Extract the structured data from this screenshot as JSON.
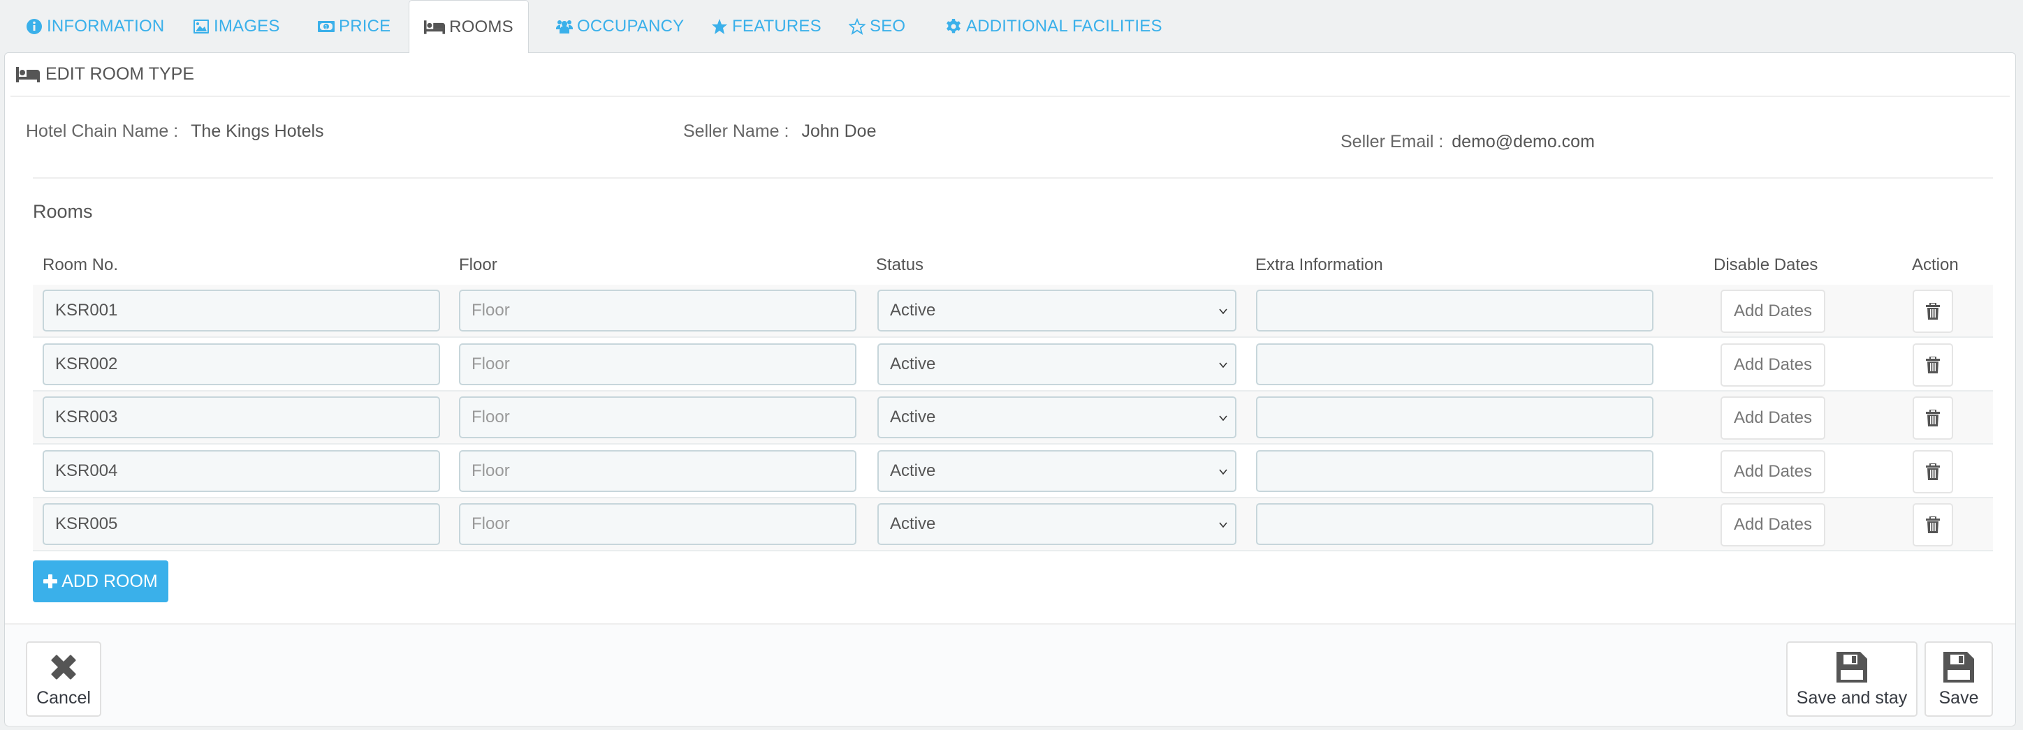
{
  "tabs": [
    {
      "label": "INFORMATION",
      "icon": "info-circle-icon",
      "active": false
    },
    {
      "label": "IMAGES",
      "icon": "image-icon",
      "active": false
    },
    {
      "label": "PRICE",
      "icon": "money-icon",
      "active": false
    },
    {
      "label": "ROOMS",
      "icon": "bed-icon",
      "active": true
    },
    {
      "label": "OCCUPANCY",
      "icon": "users-icon",
      "active": false
    },
    {
      "label": "FEATURES",
      "icon": "star-icon",
      "active": false
    },
    {
      "label": "SEO",
      "icon": "star-outline-icon",
      "active": false
    },
    {
      "label": "ADDITIONAL FACILITIES",
      "icon": "gear-icon",
      "active": false
    }
  ],
  "panel": {
    "title": "EDIT ROOM TYPE",
    "title_icon": "bed-icon"
  },
  "info": {
    "hotel_chain_label": "Hotel Chain Name :",
    "hotel_chain_value": "The Kings Hotels",
    "seller_name_label": "Seller Name :",
    "seller_name_value": "John Doe",
    "seller_email_label": "Seller Email :",
    "seller_email_value": "demo@demo.com"
  },
  "rooms": {
    "section_label": "Rooms",
    "columns": [
      "Room No.",
      "Floor",
      "Status",
      "Extra Information",
      "Disable Dates",
      "Action"
    ],
    "floor_placeholder": "Floor",
    "add_dates_label": "Add Dates",
    "rows": [
      {
        "room_no": "KSR001",
        "floor": "",
        "status": "Active",
        "extra_info": ""
      },
      {
        "room_no": "KSR002",
        "floor": "",
        "status": "Active",
        "extra_info": ""
      },
      {
        "room_no": "KSR003",
        "floor": "",
        "status": "Active",
        "extra_info": ""
      },
      {
        "room_no": "KSR004",
        "floor": "",
        "status": "Active",
        "extra_info": ""
      },
      {
        "room_no": "KSR005",
        "floor": "",
        "status": "Active",
        "extra_info": ""
      }
    ],
    "add_room_label": "ADD ROOM"
  },
  "footer": {
    "cancel_label": "Cancel",
    "save_and_stay_label": "Save and stay",
    "save_label": "Save"
  },
  "colors": {
    "accent": "#3ab0ea",
    "text": "#555555",
    "page_bg": "#eff1f2"
  }
}
